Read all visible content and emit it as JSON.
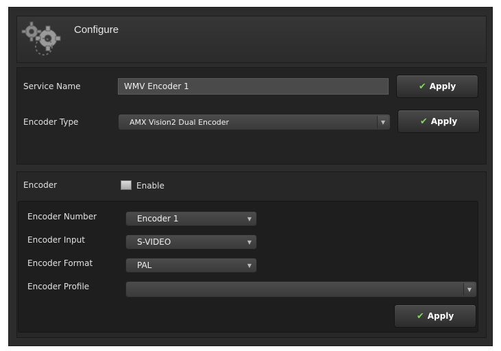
{
  "header": {
    "title": "Configure",
    "icon": "gears-icon"
  },
  "service": {
    "name_label": "Service Name",
    "name_value": "WMV Encoder 1",
    "apply_label": "Apply"
  },
  "encoder_type": {
    "label": "Encoder Type",
    "selected": "AMX Vision2 Dual Encoder",
    "apply_label": "Apply"
  },
  "encoder": {
    "label": "Encoder",
    "enable_label": "Enable",
    "enabled": false,
    "number_label": "Encoder Number",
    "number_value": "Encoder 1",
    "input_label": "Encoder Input",
    "input_value": "S-VIDEO",
    "format_label": "Encoder Format",
    "format_value": "PAL",
    "profile_label": "Encoder Profile",
    "profile_value": "",
    "apply_label": "Apply"
  },
  "colors": {
    "background": "#2c2c2c",
    "check": "#7ed957"
  }
}
